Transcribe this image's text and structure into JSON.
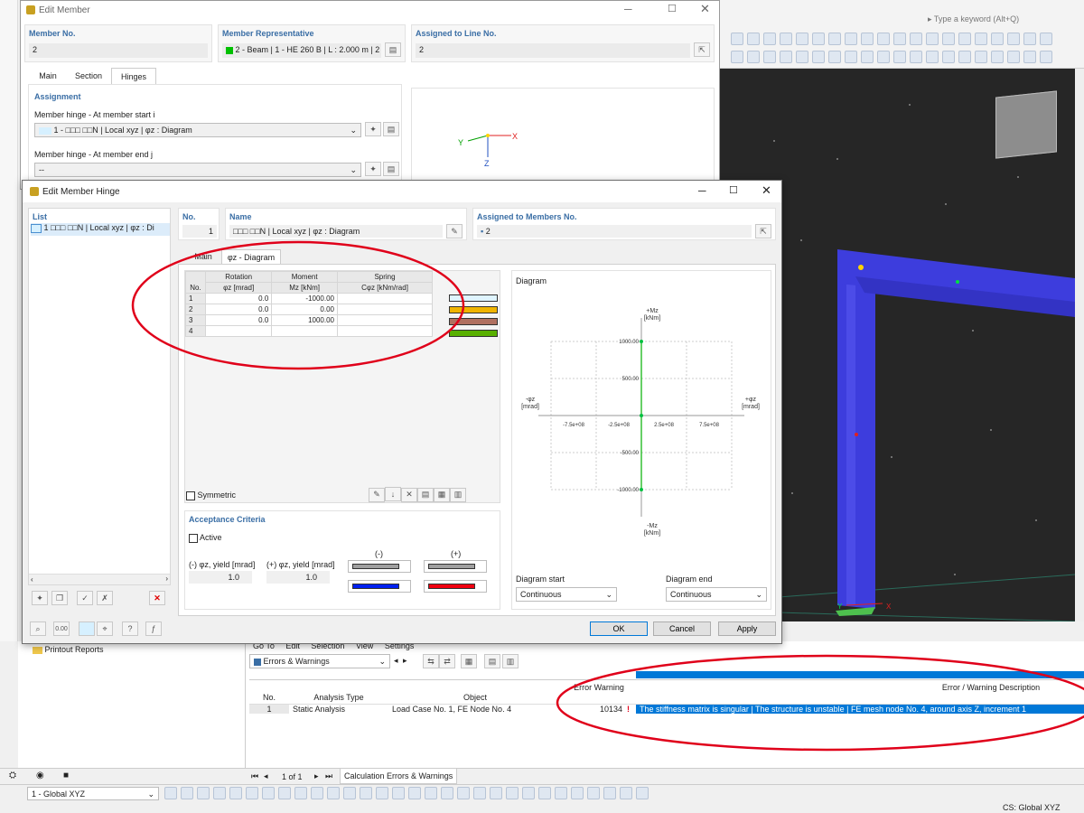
{
  "search_placeholder": "Type a keyword (Alt+Q)",
  "edit_member": {
    "title": "Edit Member",
    "member_no_label": "Member No.",
    "member_no_value": "2",
    "rep_label": "Member Representative",
    "rep_value": "2 - Beam | 1 - HE 260 B | L : 2.000 m | 2",
    "line_label": "Assigned to Line No.",
    "line_value": "2",
    "tabs": [
      "Main",
      "Section",
      "Hinges"
    ],
    "assignment_label": "Assignment",
    "hinge_start_label": "Member hinge - At member start i",
    "hinge_start_value": "1 - □□□ □□N | Local xyz | φz : Diagram",
    "hinge_end_label": "Member hinge - At member end j",
    "hinge_end_value": "--",
    "axis_x": "X",
    "axis_y": "Y",
    "axis_z": "Z"
  },
  "hinge_dialog": {
    "title": "Edit Member Hinge",
    "list_label": "List",
    "list_item": "1 □□□ □□N | Local xyz | φz : Di",
    "no_label": "No.",
    "no_value": "1",
    "name_label": "Name",
    "name_value": "□□□ □□N | Local xyz | φz : Diagram",
    "assigned_label": "Assigned to Members No.",
    "assigned_value": "2",
    "tab_main": "Main",
    "tab_diagram": "φz - Diagram",
    "table": {
      "headers": [
        [
          "No.",
          ""
        ],
        [
          "Rotation",
          "φz [mrad]"
        ],
        [
          "Moment",
          "Mz [kNm]"
        ],
        [
          "Spring",
          "Cφz [kNm/rad]"
        ]
      ],
      "rows": [
        [
          "1",
          "0.0",
          "-1000.00",
          ""
        ],
        [
          "2",
          "0.0",
          "0.00",
          ""
        ],
        [
          "3",
          "0.0",
          "1000.00",
          ""
        ],
        [
          "4",
          "",
          "",
          ""
        ]
      ]
    },
    "symmetric_label": "Symmetric",
    "acceptance_label": "Acceptance Criteria",
    "active_label": "Active",
    "neg_yield_label": "(-) φz, yield [mrad]",
    "pos_yield_label": "(+) φz, yield [mrad]",
    "neg_yield_value": "1.0",
    "pos_yield_value": "1.0",
    "neg_label": "(-)",
    "pos_label": "(+)",
    "diagram_label": "Diagram",
    "diagram_start_label": "Diagram start",
    "diagram_start_value": "Continuous",
    "diagram_end_label": "Diagram end",
    "diagram_end_value": "Continuous",
    "ok": "OK",
    "cancel": "Cancel",
    "apply": "Apply"
  },
  "chart_data": {
    "type": "line",
    "title": "Diagram",
    "xlabel_pos": "+φz",
    "xlabel_neg": "-φz",
    "xunit": "[mrad]",
    "ylabel_pos": "+Mz",
    "ylabel_neg": "-Mz",
    "yunit": "[kNm]",
    "x_ticks": [
      "-7.5e+08",
      "-2.5e+08",
      "2.5e+08",
      "7.5e+08"
    ],
    "y_ticks": [
      "1000.00",
      "500.00",
      "-500.00",
      "-1000.00"
    ],
    "x": [
      0,
      0,
      0
    ],
    "y": [
      -1000,
      0,
      1000
    ],
    "ylim": [
      -1000,
      1000
    ]
  },
  "bottom_panel": {
    "menu": [
      "Go To",
      "Edit",
      "Selection",
      "View",
      "Settings"
    ],
    "combo": "Errors & Warnings",
    "headers": [
      "No.",
      "Analysis Type",
      "Object",
      "Error Warning",
      "Error / Warning Description"
    ],
    "row": {
      "no": "1",
      "type": "Static Analysis",
      "object": "Load Case No. 1, FE Node No. 4",
      "code": "10134",
      "desc": "The stiffness matrix is singular | The structure is unstable | FE mesh node No. 4, around axis Z, increment 1"
    },
    "pager": "1 of 1",
    "tab": "Calculation Errors & Warnings"
  },
  "navigator": {
    "printout": "Printout Reports"
  },
  "statusbar": {
    "cs_combo": "1 - Global XYZ",
    "cs_text": "CS: Global XYZ"
  },
  "colors": {
    "accent": "#3a6ea5",
    "viewport": "#262626",
    "member": "#3d3ddd",
    "error_bg": "#0078d7",
    "annotation": "#e0001a"
  }
}
